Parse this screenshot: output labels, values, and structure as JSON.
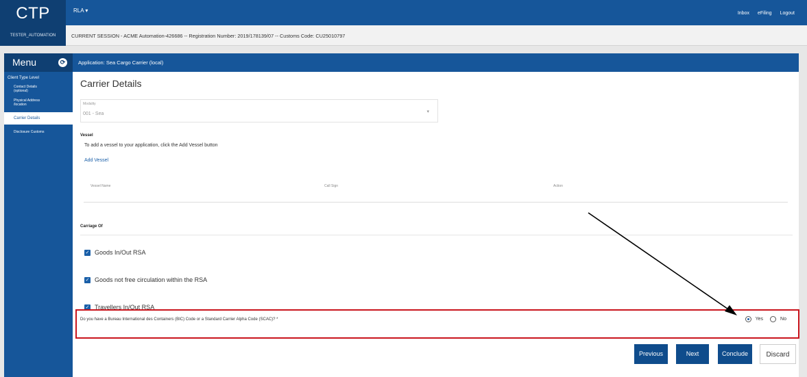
{
  "app": {
    "logo": "CTP",
    "user": "TESTER_AUTOMATION",
    "role_menu": "RLA ▾"
  },
  "top_links": [
    "Inbox",
    "eFiling",
    "Logout"
  ],
  "session": "CURRENT SESSION - ACME Automation-426686 -- Registration Number: 2019/178139/07 -- Customs Code: CU25010797",
  "sidebar": {
    "title": "Menu",
    "toggle_icon": "refresh-icon",
    "section": "Client Type Level",
    "items": [
      {
        "label": "Contact Details (optional)"
      },
      {
        "label": "Physical Address /location"
      },
      {
        "label": "Carrier Details"
      },
      {
        "label": "Disclosure Customs"
      }
    ]
  },
  "app_header": "Application: Sea Cargo Carrier (local)",
  "page": {
    "title": "Carrier Details",
    "modality_label": "Modality",
    "modality_value": "001 - Sea",
    "vessel_title": "Vessel",
    "vessel_help": "To add a vessel to your application, click the  Add Vessel  button",
    "add_vessel": "Add Vessel",
    "table_headers": [
      "Vessel Name",
      "Call Sign",
      "Action"
    ],
    "carriage_title": "Carriage Of",
    "checkboxes": [
      {
        "label": "Goods In/Out RSA",
        "checked": true
      },
      {
        "label": "Goods not free circulation within the RSA",
        "checked": true
      },
      {
        "label": "Travellers In/Out RSA",
        "checked": true
      }
    ],
    "question": "Do you have a Bureau International des Containers (BIC) Code or a Standard Carrier Alpha Code (SCAC)? *",
    "radio_yes": "Yes",
    "radio_no": "No",
    "selected": "Yes"
  },
  "buttons": {
    "previous": "Previous",
    "next": "Next",
    "conclude": "Conclude",
    "discard": "Discard"
  },
  "colors": {
    "primary": "#16569a",
    "dark": "#0f3f72",
    "highlight": "#c9141c"
  }
}
